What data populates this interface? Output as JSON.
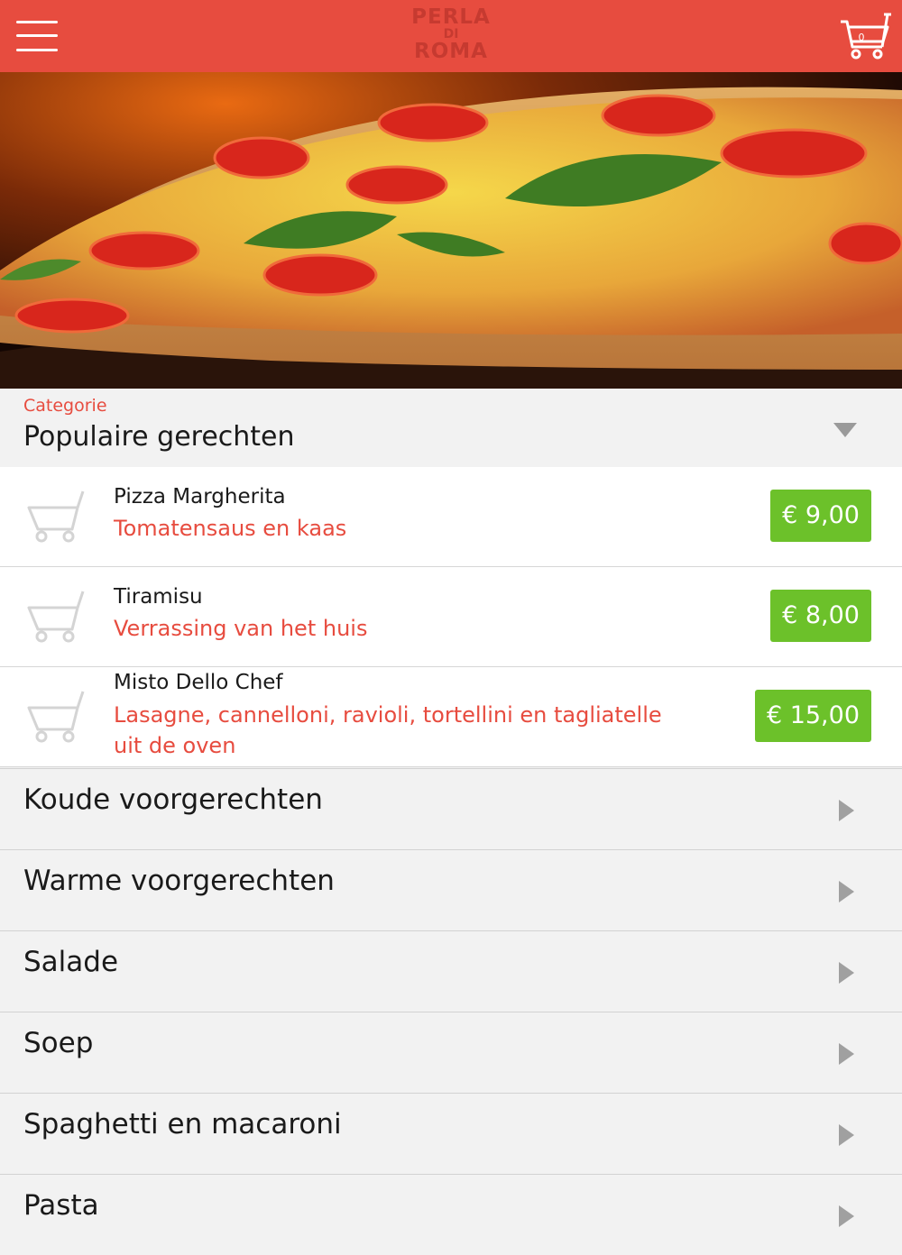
{
  "header": {
    "logo_line1": "PERLA",
    "logo_line2": "DI",
    "logo_line3": "ROMA",
    "cart_count": "0",
    "menu_icon": "hamburger-menu-icon",
    "cart_icon": "shopping-cart-icon"
  },
  "colors": {
    "brand_red": "#e74c3f",
    "price_green": "#6cc12a",
    "background_gray": "#f2f2f2"
  },
  "category_select": {
    "label": "Categorie",
    "value": "Populaire gerechten"
  },
  "items": [
    {
      "name": "Pizza Margherita",
      "description": "Tomatensaus en kaas",
      "price": "€ 9,00"
    },
    {
      "name": "Tiramisu",
      "description": "Verrassing van het huis",
      "price": "€ 8,00"
    },
    {
      "name": "Misto Dello Chef",
      "description": "Lasagne, cannelloni, ravioli, tortellini en tagliatelle uit de oven",
      "price": "€ 15,00"
    }
  ],
  "categories": [
    {
      "label": "Koude voorgerechten"
    },
    {
      "label": "Warme voorgerechten"
    },
    {
      "label": "Salade"
    },
    {
      "label": "Soep"
    },
    {
      "label": "Spaghetti en macaroni"
    },
    {
      "label": "Pasta"
    }
  ]
}
